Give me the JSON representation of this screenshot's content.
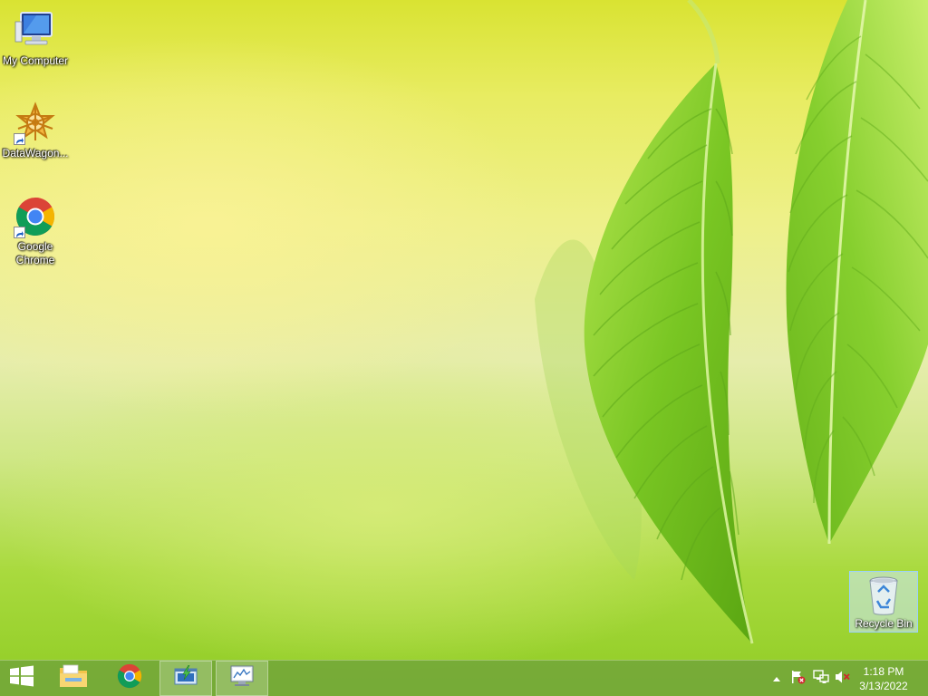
{
  "desktop": {
    "icons": [
      {
        "label": "My Computer",
        "icon": "computer-icon"
      },
      {
        "label": "DataWagon...",
        "icon": "datawagon-icon"
      },
      {
        "label": "Google Chrome",
        "icon": "chrome-icon"
      }
    ],
    "recycle_bin": {
      "label": "Recycle Bin",
      "icon": "recycle-bin-icon"
    }
  },
  "taskbar": {
    "buttons": [
      {
        "name": "start",
        "icon": "windows-logo-icon"
      },
      {
        "name": "file-explorer",
        "icon": "folder-icon"
      },
      {
        "name": "google-chrome",
        "icon": "chrome-icon"
      },
      {
        "name": "app-download",
        "icon": "download-window-icon",
        "active": true
      },
      {
        "name": "app-monitor",
        "icon": "monitor-chart-icon",
        "active": true
      }
    ],
    "tray": {
      "icons": [
        "show-hidden-icons-arrow",
        "action-center-flag-icon",
        "network-icon",
        "volume-muted-icon"
      ]
    },
    "clock": {
      "time": "1:18 PM",
      "date": "3/13/2022"
    }
  },
  "colors": {
    "taskbar": "#74a838",
    "wallpaper_top": "#d9e332",
    "wallpaper_bottom": "#8fcc24",
    "leaf": "#7ccc2a"
  }
}
